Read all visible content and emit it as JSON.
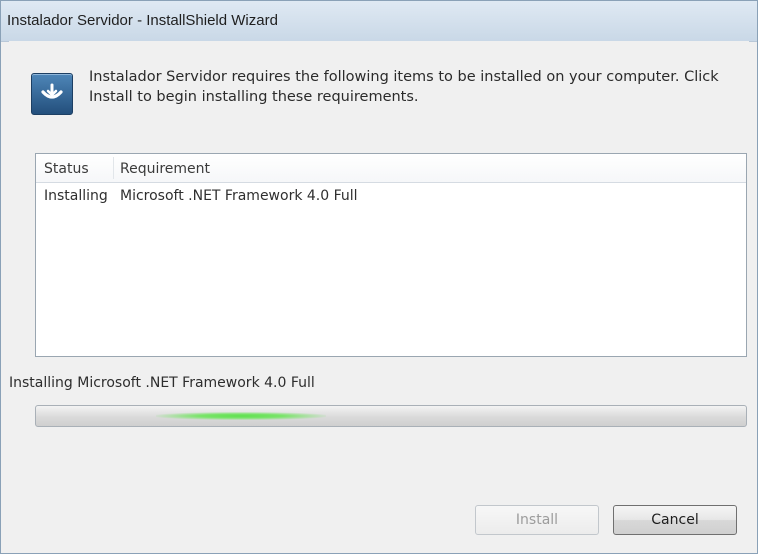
{
  "window": {
    "title": "Instalador Servidor - InstallShield Wizard"
  },
  "header": {
    "icon": "installer-icon",
    "message": "Instalador Servidor requires the following items to be installed on your computer. Click Install to begin installing these requirements."
  },
  "requirements": {
    "columns": [
      "Status",
      "Requirement"
    ],
    "rows": [
      {
        "status": "Installing",
        "requirement": "Microsoft .NET Framework 4.0 Full"
      }
    ]
  },
  "progress": {
    "label": "Installing Microsoft .NET Framework 4.0 Full",
    "mode": "indeterminate",
    "glow_color": "#5ee04f"
  },
  "buttons": {
    "install_label": "Install",
    "install_enabled": false,
    "cancel_label": "Cancel"
  }
}
